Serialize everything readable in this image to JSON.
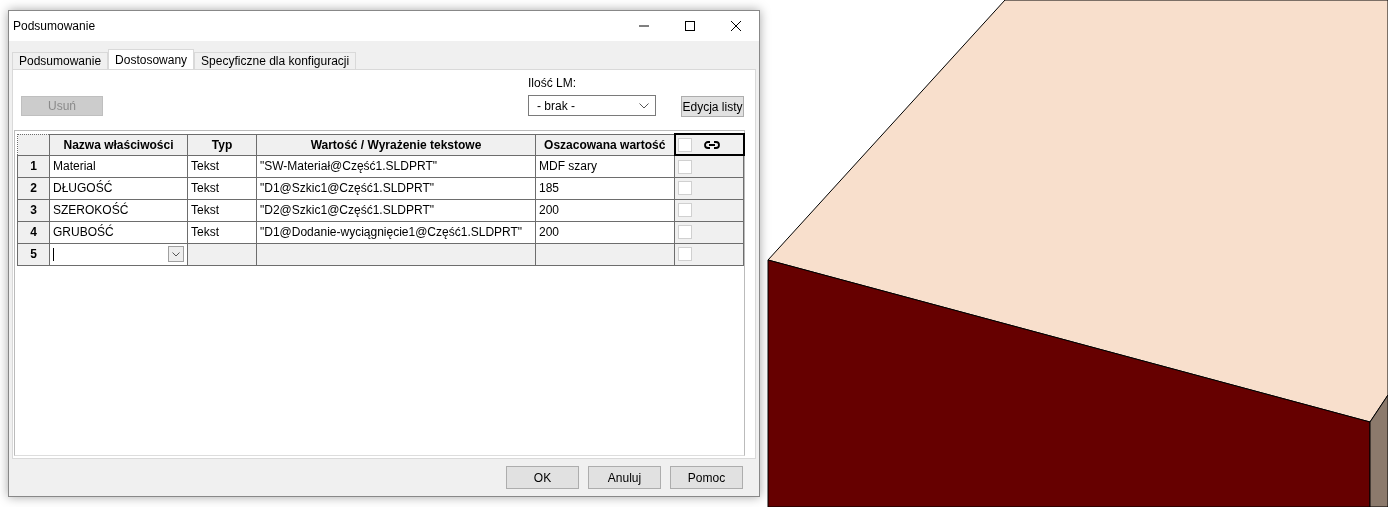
{
  "window": {
    "title": "Podsumowanie"
  },
  "tabs": [
    {
      "label": "Podsumowanie",
      "selected": false
    },
    {
      "label": "Dostosowany",
      "selected": true
    },
    {
      "label": "Specyficzne dla konfiguracji",
      "selected": false
    }
  ],
  "delete_button": {
    "label": "Usuń",
    "disabled": true
  },
  "bom_quantity": {
    "label": "Ilość LM:",
    "value": "- brak -"
  },
  "edit_list_button": {
    "label": "Edycja listy"
  },
  "table": {
    "columns": [
      "Nazwa właściwości",
      "Typ",
      "Wartość / Wyrażenie tekstowe",
      "Oszacowana wartość"
    ],
    "link_column_checked": false,
    "rows": [
      {
        "number": "1",
        "name": "Material",
        "type": "Tekst",
        "value": "\"SW-Materiał@Część1.SLDPRT\"",
        "evaluated": "MDF szary",
        "checked": false
      },
      {
        "number": "2",
        "name": "DŁUGOŚĆ",
        "type": "Tekst",
        "value": "\"D1@Szkic1@Część1.SLDPRT\"",
        "evaluated": "185",
        "checked": false
      },
      {
        "number": "3",
        "name": "SZEROKOŚĆ",
        "type": "Tekst",
        "value": "\"D2@Szkic1@Część1.SLDPRT\"",
        "evaluated": "200",
        "checked": false
      },
      {
        "number": "4",
        "name": "GRUBOŚĆ",
        "type": "Tekst",
        "value": "\"D1@Dodanie-wyciągnięcie1@Część1.SLDPRT\"",
        "evaluated": "200",
        "checked": false
      },
      {
        "number": "5",
        "kind": "editing",
        "checked": false
      }
    ]
  },
  "buttons": [
    "OK",
    "Anuluj",
    "Pomoc"
  ]
}
